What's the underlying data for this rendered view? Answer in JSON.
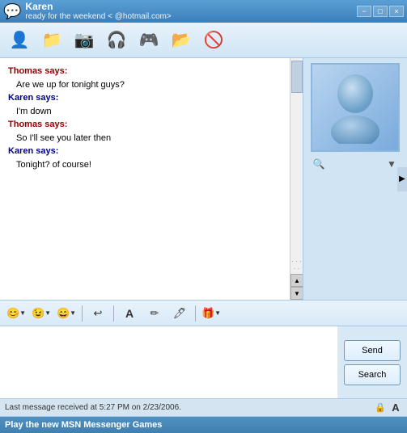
{
  "titleBar": {
    "name": "Karen",
    "status": "ready for the weekend <",
    "email": "@hotmail.com>",
    "controls": {
      "minimize": "−",
      "maximize": "□",
      "close": "×"
    }
  },
  "toolbar": {
    "buttons": [
      {
        "name": "add-contact",
        "icon": "👤",
        "label": "Add Contact"
      },
      {
        "name": "send-file",
        "icon": "📁",
        "label": "Send File"
      },
      {
        "name": "webcam",
        "icon": "📷",
        "label": "Webcam"
      },
      {
        "name": "voicechat",
        "icon": "🎧",
        "label": "Voice Chat"
      },
      {
        "name": "games",
        "icon": "🎮",
        "label": "Games"
      },
      {
        "name": "share-folder",
        "icon": "📂",
        "label": "Share Folders"
      },
      {
        "name": "block",
        "icon": "🚫",
        "label": "Block"
      }
    ]
  },
  "chat": {
    "messages": [
      {
        "sender": "Thomas",
        "senderType": "thomas",
        "text": "Thomas says:"
      },
      {
        "type": "message",
        "text": "Are we up for tonight guys?"
      },
      {
        "sender": "Karen",
        "senderType": "karen",
        "text": "Karen says:"
      },
      {
        "type": "message",
        "text": "I'm down"
      },
      {
        "sender": "Thomas",
        "senderType": "thomas",
        "text": "Thomas says:"
      },
      {
        "type": "message",
        "text": "So I'll see you later then"
      },
      {
        "sender": "Karen",
        "senderType": "karen",
        "text": "Karen says:"
      },
      {
        "type": "message",
        "text": "Tonight? of course!"
      }
    ]
  },
  "formatBar": {
    "buttons": [
      {
        "name": "emoji",
        "icon": "😊",
        "dropdown": true
      },
      {
        "name": "wink",
        "icon": "😉",
        "dropdown": true
      },
      {
        "name": "emoticons",
        "icon": "😄",
        "dropdown": true
      },
      {
        "name": "undo",
        "icon": "↩"
      },
      {
        "name": "font",
        "icon": "A",
        "styled": true
      },
      {
        "name": "pen",
        "icon": "✏"
      },
      {
        "name": "draw",
        "icon": "🖊"
      },
      {
        "name": "gift",
        "icon": "🎁",
        "dropdown": true
      }
    ]
  },
  "buttons": {
    "send": "Send",
    "search": "Search"
  },
  "statusBar": {
    "text": "Last message received at 5:27 PM on 2/23/2006.",
    "icons": [
      "🔒",
      "A"
    ]
  },
  "bottomBar": {
    "text": "Play the new MSN Messenger Games"
  }
}
